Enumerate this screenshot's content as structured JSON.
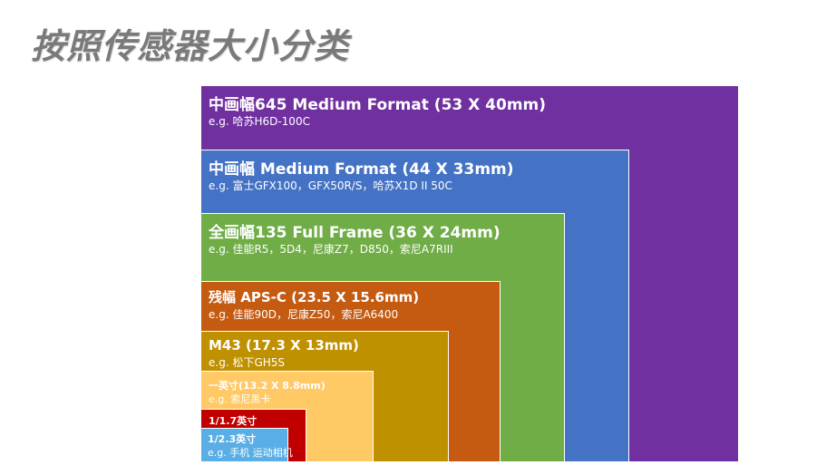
{
  "title": "按照传感器大小分类",
  "colors": {
    "medium_format_645": "#7030a0",
    "medium_format": "#4472c4",
    "full_frame": "#70ad47",
    "aps_c": "#c55a11",
    "m43": "#bf9000",
    "one_inch": "#ffc966",
    "one_1_7": "#c00000",
    "one_2_3": "#5aaee6"
  },
  "sensors": [
    {
      "name": "中画幅645 Medium Format (53 X 40mm)",
      "example": "e.g. 哈苏H6D-100C"
    },
    {
      "name": "中画幅 Medium Format (44 X 33mm)",
      "example": "e.g. 富士GFX100，GFX50R/S，哈苏X1D II 50C"
    },
    {
      "name": "全画幅135 Full Frame (36 X 24mm)",
      "example": "e.g. 佳能R5，5D4，尼康Z7，D850，索尼A7RIII"
    },
    {
      "name": "残幅 APS-C (23.5 X 15.6mm)",
      "example": "e.g. 佳能90D，尼康Z50，索尼A6400"
    },
    {
      "name": "M43 (17.3 X 13mm)",
      "example": "e.g. 松下GH5S"
    },
    {
      "name": "一英寸(13.2 X 8.8mm)",
      "example": "e.g. 索尼黑卡"
    },
    {
      "name": "1/1.7英寸",
      "example": ""
    },
    {
      "name": "1/2.3英寸",
      "example": "e.g. 手机 运动相机"
    }
  ]
}
